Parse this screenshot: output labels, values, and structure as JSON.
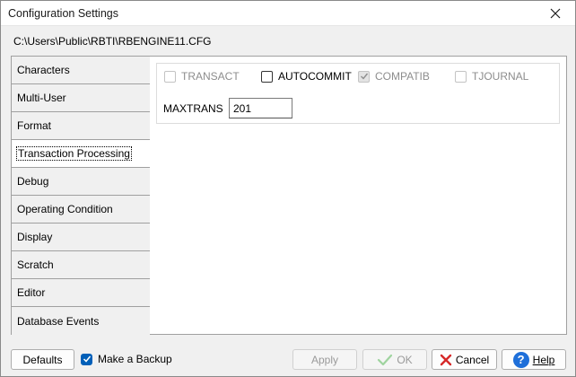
{
  "window": {
    "title": "Configuration Settings",
    "path": "C:\\Users\\Public\\RBTI\\RBENGINE11.CFG"
  },
  "tabs": [
    {
      "label": "Characters"
    },
    {
      "label": "Multi-User"
    },
    {
      "label": "Format"
    },
    {
      "label": "Transaction Processing",
      "active": true
    },
    {
      "label": "Debug"
    },
    {
      "label": "Operating Condition"
    },
    {
      "label": "Display"
    },
    {
      "label": "Scratch"
    },
    {
      "label": "Editor"
    },
    {
      "label": "Database Events"
    }
  ],
  "options": {
    "transact": {
      "label": "TRANSACT",
      "checked": false,
      "enabled": false
    },
    "autocommit": {
      "label": "AUTOCOMMIT",
      "checked": false,
      "enabled": true
    },
    "compatib": {
      "label": "COMPATIB",
      "checked": true,
      "enabled": false
    },
    "tjournal": {
      "label": "TJOURNAL",
      "checked": false,
      "enabled": false
    }
  },
  "maxtrans": {
    "label": "MAXTRANS",
    "value": "201"
  },
  "footer": {
    "defaults": "Defaults",
    "backup": "Make a Backup",
    "apply": "Apply",
    "ok": "OK",
    "cancel": "Cancel",
    "help": "Help"
  },
  "colors": {
    "accent": "#005fb8",
    "ok_check": "#6dbf6d",
    "cancel_x": "#d62828",
    "help_blue": "#1e6fd9"
  }
}
